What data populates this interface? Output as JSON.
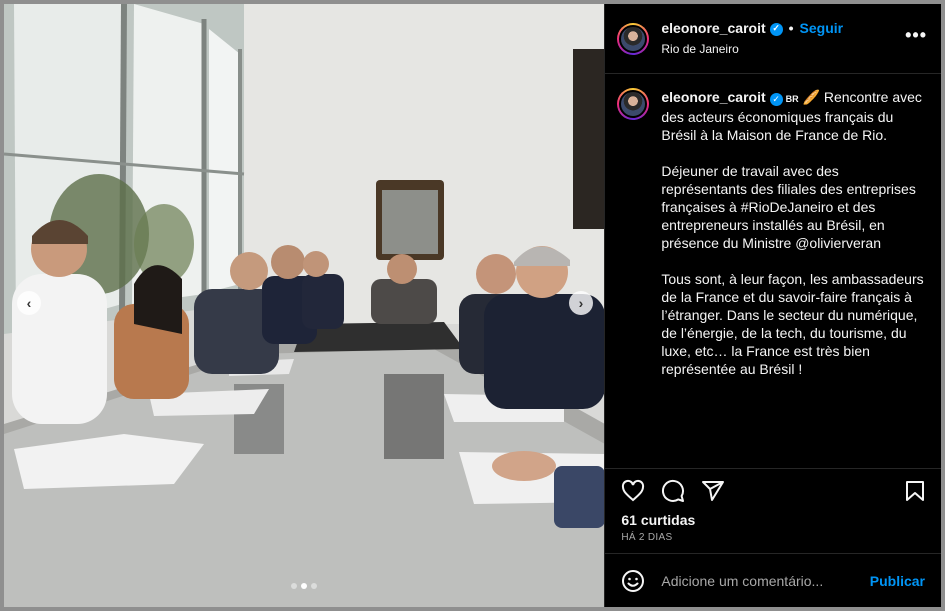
{
  "post": {
    "username": "eleonore_caroit",
    "follow_label": "Seguir",
    "separator": "•",
    "location": "Rio de Janeiro",
    "more_icon": "more-horizontal-icon",
    "verified_icon": "verified-badge-icon",
    "caption": {
      "username": "eleonore_caroit",
      "badge": "BR",
      "paragraphs": [
        "🥖 Rencontre avec des acteurs économiques français du Brésil à la Maison de France de Rio.",
        "Déjeuner de travail avec des représentants des filiales des entreprises françaises à #RioDeJaneiro et des entrepreneurs installés au Brésil, en présence du Ministre @olivierveran",
        "Tous sont, à leur façon, les ambassadeurs de la France et du savoir-faire français à l’étranger. Dans le secteur du numérique, de l’énergie, de la tech, du tourisme, du luxe, etc… la France est très bien représentée au Brésil !"
      ]
    },
    "likes": "61 curtidas",
    "date": "HÁ 2 DIAS",
    "comment_placeholder": "Adicione um comentário...",
    "publish_label": "Publicar"
  },
  "carousel": {
    "prev_icon": "chevron-left-icon",
    "next_icon": "chevron-right-icon",
    "slide_count": 3,
    "active_index": 1
  },
  "colors": {
    "accent": "#0095f6",
    "background": "#000000",
    "text": "#f5f5f5",
    "muted": "#a8a8a8"
  }
}
